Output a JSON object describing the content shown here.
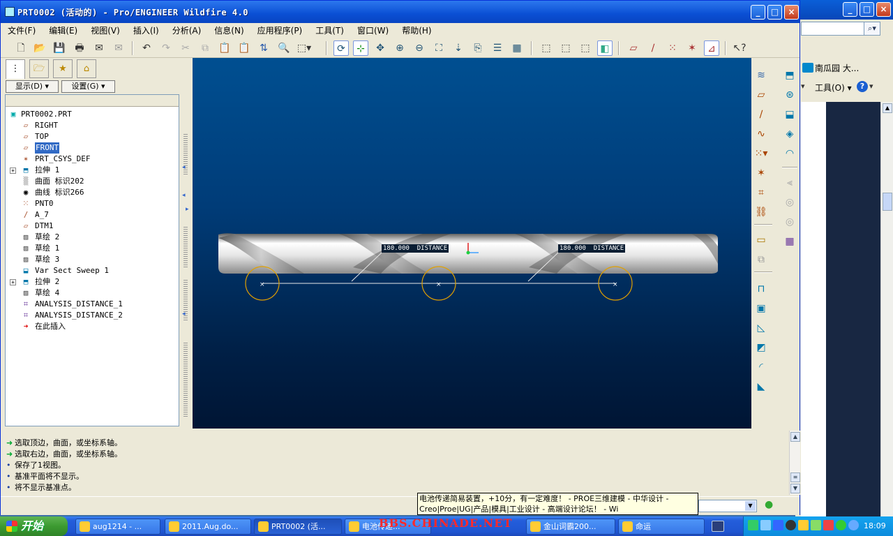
{
  "window": {
    "title": "PRT0002 (活动的) - Pro/ENGINEER Wildfire 4.0",
    "close": "×",
    "minimize": "_",
    "maximize": "□"
  },
  "menu": [
    "文件(F)",
    "编辑(E)",
    "视图(V)",
    "插入(I)",
    "分析(A)",
    "信息(N)",
    "应用程序(P)",
    "工具(T)",
    "窗口(W)",
    "帮助(H)"
  ],
  "nav": {
    "show_btn": "显示(D) ▾",
    "settings_btn": "设置(G) ▾"
  },
  "tree": [
    {
      "label": "PRT0002.PRT",
      "icon": "part-icon",
      "indent": 0,
      "expander": ""
    },
    {
      "label": "RIGHT",
      "icon": "datum-plane-icon",
      "indent": 1,
      "expander": ""
    },
    {
      "label": "TOP",
      "icon": "datum-plane-icon",
      "indent": 1,
      "expander": ""
    },
    {
      "label": "FRONT",
      "icon": "datum-plane-icon",
      "indent": 1,
      "expander": "",
      "selected": true
    },
    {
      "label": "PRT_CSYS_DEF",
      "icon": "csys-icon",
      "indent": 1,
      "expander": ""
    },
    {
      "label": "拉伸 1",
      "icon": "extrude-icon",
      "indent": 1,
      "expander": "+"
    },
    {
      "label": "曲面 标识202",
      "icon": "surface-icon",
      "indent": 1,
      "expander": ""
    },
    {
      "label": "曲线 标识266",
      "icon": "curve-icon",
      "indent": 1,
      "expander": ""
    },
    {
      "label": "PNT0",
      "icon": "datum-point-icon",
      "indent": 1,
      "expander": ""
    },
    {
      "label": "A_7",
      "icon": "datum-axis-icon",
      "indent": 1,
      "expander": ""
    },
    {
      "label": "DTM1",
      "icon": "datum-plane-icon",
      "indent": 1,
      "expander": ""
    },
    {
      "label": "草绘 2",
      "icon": "sketch-icon",
      "indent": 1,
      "expander": ""
    },
    {
      "label": "草绘 1",
      "icon": "sketch-icon",
      "indent": 1,
      "expander": ""
    },
    {
      "label": "草绘 3",
      "icon": "sketch-icon",
      "indent": 1,
      "expander": ""
    },
    {
      "label": "Var Sect Sweep 1",
      "icon": "sweep-icon",
      "indent": 1,
      "expander": ""
    },
    {
      "label": "拉伸 2",
      "icon": "extrude-icon",
      "indent": 1,
      "expander": "+"
    },
    {
      "label": "草绘 4",
      "icon": "sketch-icon",
      "indent": 1,
      "expander": ""
    },
    {
      "label": "ANALYSIS_DISTANCE_1",
      "icon": "analysis-icon",
      "indent": 1,
      "expander": ""
    },
    {
      "label": "ANALYSIS_DISTANCE_2",
      "icon": "analysis-icon",
      "indent": 1,
      "expander": ""
    },
    {
      "label": "在此插入",
      "icon": "insert-here-icon",
      "indent": 1,
      "expander": ""
    }
  ],
  "viewport": {
    "dim1": "180.000  DISTANCE",
    "dim2": "180.000  DISTANCE"
  },
  "messages": [
    {
      "text": "选取顶边，曲面，或坐标系轴。",
      "icon": "arrow-icon"
    },
    {
      "text": "选取右边，曲面，或坐标系轴。",
      "icon": "arrow-icon"
    },
    {
      "text": "保存了1视图。",
      "icon": "bullet-icon"
    },
    {
      "text": "基准平面将不显示。",
      "icon": "bullet-icon"
    },
    {
      "text": "将不显示基准点。",
      "icon": "bullet-icon"
    }
  ],
  "tooltip": {
    "line1": "电池传递简易装置，+10分，有一定难度！ - PROE三维建模 - 中华设计 -",
    "line2": "Creo|Proe|UG|产品|模具|工业设计 - 高端设计论坛！ - Wi"
  },
  "browser": {
    "link": "南瓜园 大...",
    "tools": "工具(O) ▾"
  },
  "taskbar": {
    "start": "开始",
    "tasks": [
      "aug1214 - ...",
      "2011.Aug.do...",
      "PRT0002 (活...",
      "电池传递...",
      "...",
      "金山词霸200...",
      "命运"
    ],
    "clock": "18:09",
    "watermark": "BBS.CHINADE.NET"
  }
}
